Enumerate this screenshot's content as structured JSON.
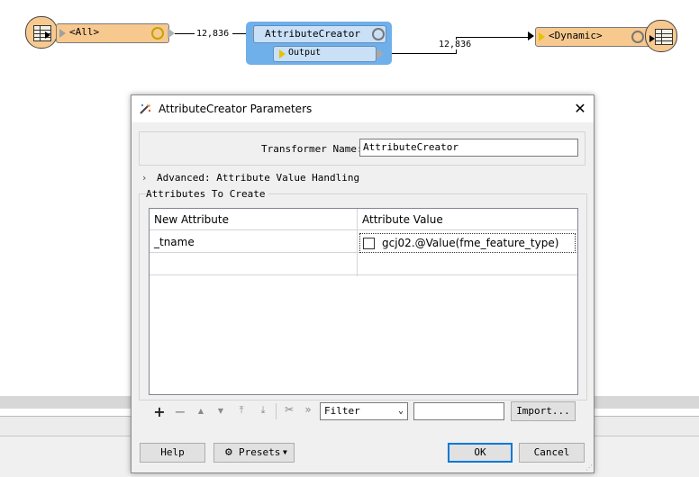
{
  "canvas": {
    "reader_port_label": "<All>",
    "transformer_title": "AttributeCreator",
    "transformer_output_label": "Output",
    "writer_port_label": "<Dynamic>",
    "count_in": "12,836",
    "count_out": "12,836"
  },
  "dialog": {
    "title": "AttributeCreator Parameters",
    "transformer_name_label": "Transformer Name:",
    "transformer_name_value": "AttributeCreator",
    "advanced_label": "Advanced: Attribute Value Handling",
    "group_label": "Attributes To Create",
    "table": {
      "headers": [
        "New Attribute",
        "Attribute Value"
      ],
      "rows": [
        {
          "name": "_tname",
          "value": "gcj02.@Value(fme_feature_type)"
        },
        {
          "name": "",
          "value": ""
        }
      ]
    },
    "toolbar": {
      "add": "+",
      "remove": "−",
      "move_up": "▲",
      "move_down": "▼",
      "move_top": "⤒",
      "move_bottom": "⤓",
      "cut": "✂",
      "more": "»",
      "filter_selected": "Filter",
      "filter_text": "",
      "import_label": "Import..."
    },
    "buttons": {
      "help": "Help",
      "presets": "Presets",
      "ok": "OK",
      "cancel": "Cancel"
    }
  }
}
